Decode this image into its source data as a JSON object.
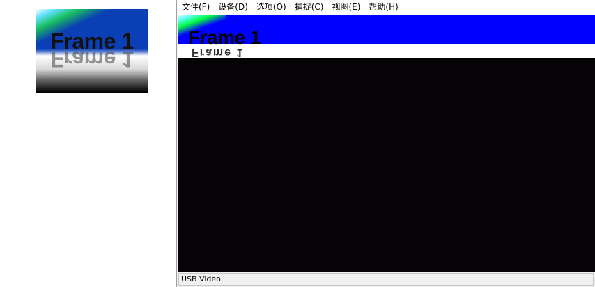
{
  "thumbnail": {
    "text": "Frame 1"
  },
  "window": {
    "menu": [
      {
        "label": "文件(F)"
      },
      {
        "label": "设备(D)"
      },
      {
        "label": "选项(O)"
      },
      {
        "label": "捕捉(C)"
      },
      {
        "label": "视图(E)"
      },
      {
        "label": "帮助(H)"
      }
    ],
    "video": {
      "text": "Frame 1"
    },
    "status": {
      "device": "USB Video"
    }
  },
  "colors": {
    "video_background": "#050305",
    "video_blue": "#0000ff",
    "thumbnail_blue": "#0a3fb5"
  }
}
